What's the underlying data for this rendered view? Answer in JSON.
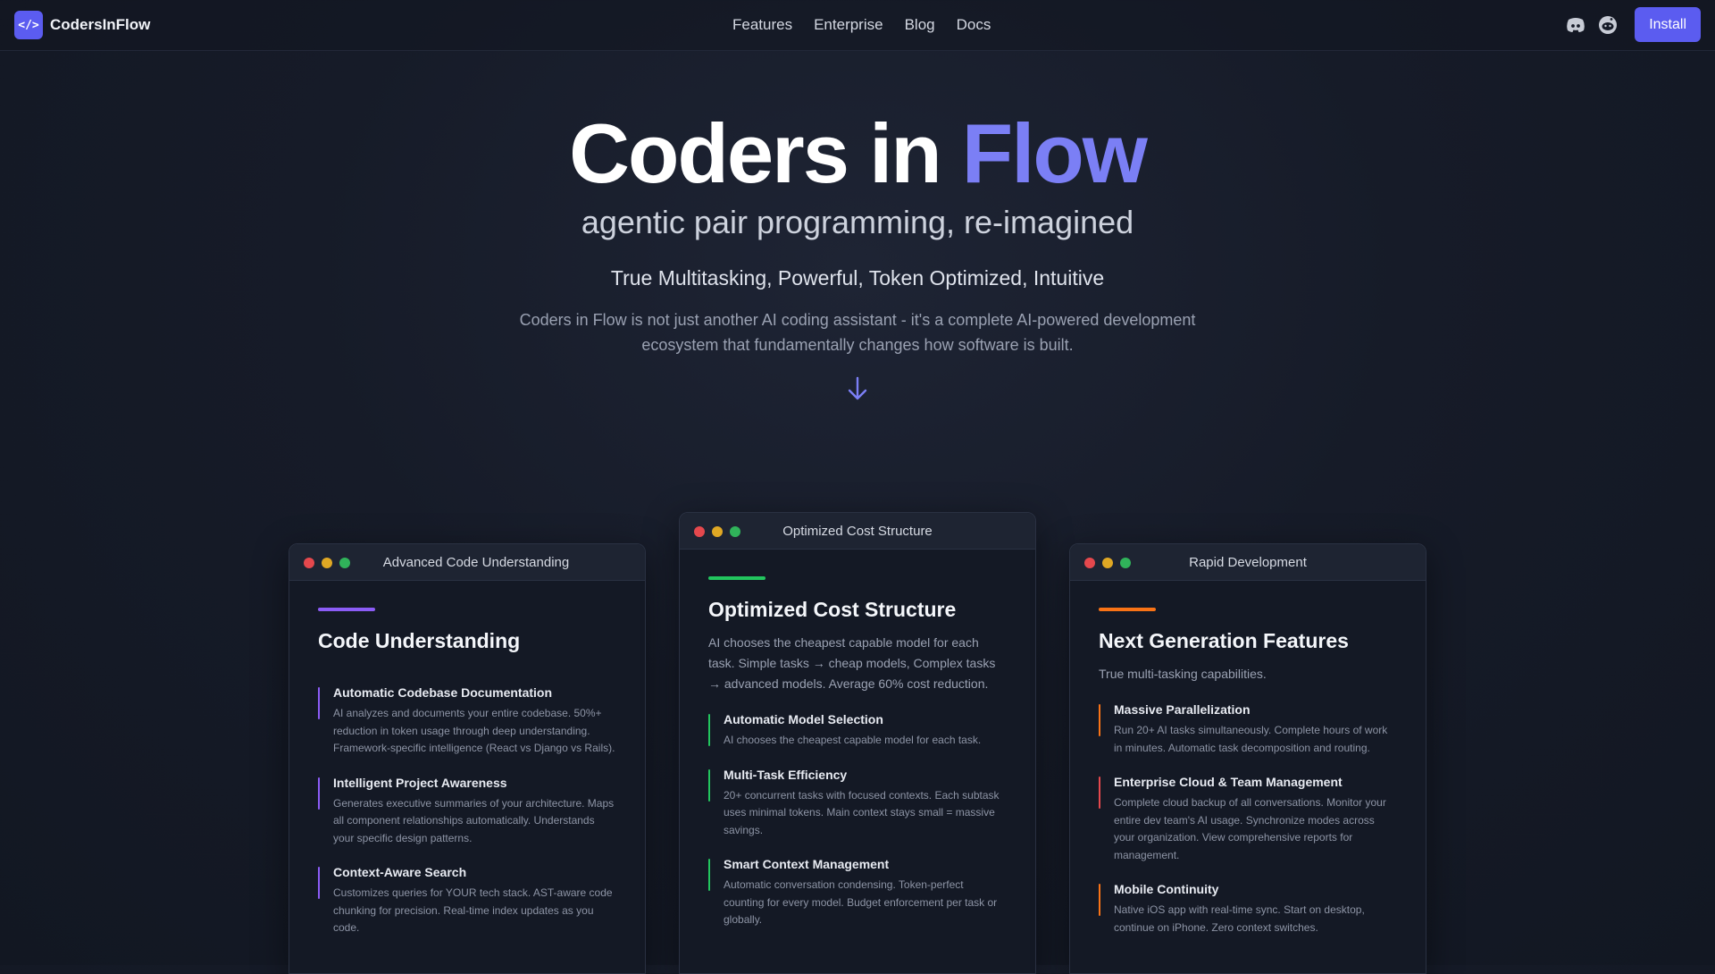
{
  "nav": {
    "brand_icon": "code-brackets-icon",
    "brand_name": "CodersInFlow",
    "links": [
      "Features",
      "Enterprise",
      "Blog",
      "Docs"
    ],
    "discord_icon": "discord-icon",
    "reddit_icon": "reddit-icon",
    "install_label": "Install",
    "accent_color": "#5b5cf0"
  },
  "hero": {
    "title_main": "Coders in ",
    "title_accent": "Flow",
    "subtitle": "agentic pair programming, re-imagined",
    "tagline": "True Multitasking, Powerful, Token Optimized, Intuitive",
    "description": "Coders in Flow is not just another AI coding assistant - it's a complete AI-powered development ecosystem that fundamentally changes how software is built.",
    "arrow_icon": "arrow-down-icon"
  },
  "cards": [
    {
      "window_title": "Advanced Code Understanding",
      "accent": "#8b5cf6",
      "heading": "Code Understanding",
      "intro": "",
      "features": [
        {
          "title": "Automatic Codebase Documentation",
          "text": "AI analyzes and documents your entire codebase. 50%+ reduction in token usage through deep understanding. Framework-specific intelligence (React vs Django vs Rails)."
        },
        {
          "title": "Intelligent Project Awareness",
          "text": "Generates executive summaries of your architecture. Maps all component relationships automatically. Understands your specific design patterns."
        },
        {
          "title": "Context-Aware Search",
          "text": "Customizes queries for YOUR tech stack. AST-aware code chunking for precision. Real-time index updates as you code."
        }
      ]
    },
    {
      "window_title": "Optimized Cost Structure",
      "accent": "#22c55e",
      "heading": "Optimized Cost Structure",
      "intro": "AI chooses the cheapest capable model for each task. Simple tasks → cheap models, Complex tasks → advanced models. Average 60% cost reduction.",
      "features": [
        {
          "title": "Automatic Model Selection",
          "text": "AI chooses the cheapest capable model for each task."
        },
        {
          "title": "Multi-Task Efficiency",
          "text": "20+ concurrent tasks with focused contexts. Each subtask uses minimal tokens. Main context stays small = massive savings."
        },
        {
          "title": "Smart Context Management",
          "text": "Automatic conversation condensing. Token-perfect counting for every model. Budget enforcement per task or globally."
        }
      ]
    },
    {
      "window_title": "Rapid Development",
      "accent": "#f97316",
      "heading": "Next Generation Features",
      "intro": "True multi-tasking capabilities.",
      "features": [
        {
          "title": "Massive Parallelization",
          "text": "Run 20+ AI tasks simultaneously. Complete hours of work in minutes. Automatic task decomposition and routing."
        },
        {
          "title": "Enterprise Cloud & Team Management",
          "text": "Complete cloud backup of all conversations. Monitor your entire dev team's AI usage. Synchronize modes across your organization. View comprehensive reports for management."
        },
        {
          "title": "Mobile Continuity",
          "text": "Native iOS app with real-time sync. Start on desktop, continue on iPhone. Zero context switches."
        }
      ]
    }
  ]
}
